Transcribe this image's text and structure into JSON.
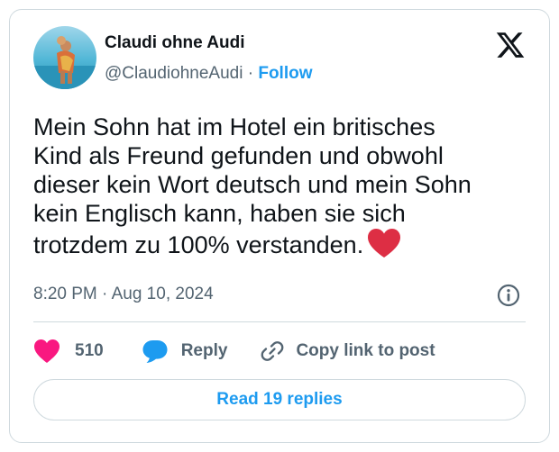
{
  "author": {
    "name": "Claudi ohne Audi",
    "handle": "@ClaudiohneAudi",
    "separator": " · ",
    "follow_label": "Follow"
  },
  "tweet": {
    "text": "Mein Sohn hat im Hotel ein britisches\nKind als Freund gefunden und obwohl\ndieser kein Wort deutsch und mein Sohn\nkein Englisch kann, haben sie sich\ntrotzdem zu 100% verstanden.",
    "emoji": "red-heart",
    "timestamp": "8:20 PM · Aug 10, 2024"
  },
  "actions": {
    "like_count": "510",
    "reply_label": "Reply",
    "copy_label": "Copy link to post"
  },
  "read_replies_label": "Read 19 replies",
  "icons": {
    "logo": "x-logo-icon",
    "info": "info-icon",
    "like": "heart-icon",
    "reply": "reply-bubble-icon",
    "copy": "link-icon"
  },
  "colors": {
    "accent": "#1d9bf0",
    "like": "#f91880",
    "secondary_text": "#536471",
    "border": "#cfd9de"
  }
}
